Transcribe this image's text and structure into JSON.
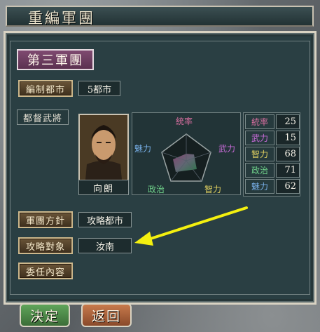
{
  "window": {
    "title": "重編軍團"
  },
  "corps": {
    "name": "第三軍團"
  },
  "cities": {
    "button_label": "編制都市",
    "value": "5都市"
  },
  "governor": {
    "label": "都督武將",
    "name": "向朗",
    "portrait_icon": "general-portrait-icon"
  },
  "radar": {
    "labels": {
      "top": "統率",
      "left": "魅力",
      "right": "武力",
      "bottom_left": "政治",
      "bottom_right": "智力"
    }
  },
  "stats": [
    {
      "name": "統率",
      "value": "25",
      "color": "#d86fa0"
    },
    {
      "name": "武力",
      "value": "15",
      "color": "#c66ad6"
    },
    {
      "name": "智力",
      "value": "68",
      "color": "#e0d060"
    },
    {
      "name": "政治",
      "value": "71",
      "color": "#6fd08a"
    },
    {
      "name": "魅力",
      "value": "62",
      "color": "#77aee6"
    }
  ],
  "policy": {
    "button_label": "軍團方針",
    "value": "攻略都市"
  },
  "target": {
    "button_label": "攻略對象",
    "value": "汝南"
  },
  "delegate": {
    "button_label": "委任內容"
  },
  "buttons": {
    "confirm": "決定",
    "back": "返回"
  },
  "colors": {
    "panel": "#2a3f43",
    "accent": "#7f4a71",
    "confirm": "#4f8a4a",
    "back": "#b06a40",
    "arrow": "#f4f00f"
  }
}
